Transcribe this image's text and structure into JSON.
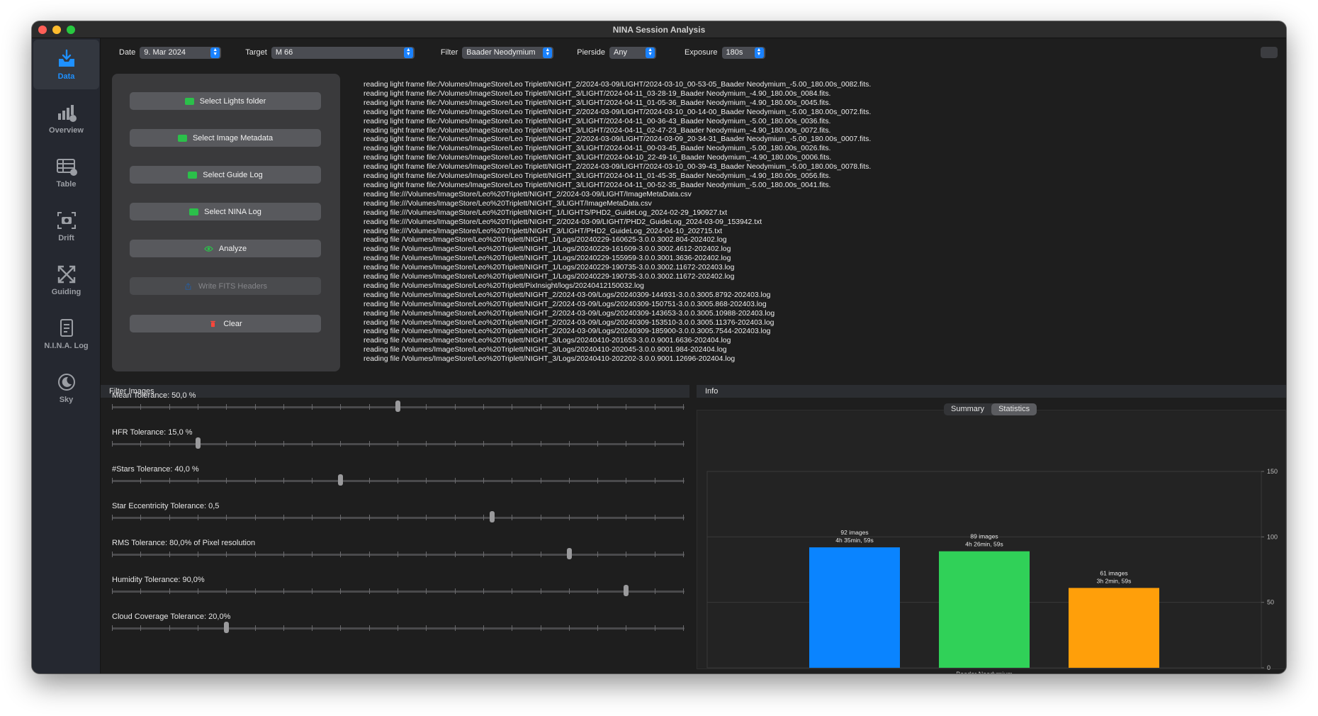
{
  "window": {
    "title": "NINA Session Analysis"
  },
  "sidebar": {
    "items": [
      {
        "label": "Data",
        "icon": "tray-download-icon",
        "active": true
      },
      {
        "label": "Overview",
        "icon": "chart-badge-icon",
        "active": false
      },
      {
        "label": "Table",
        "icon": "table-icon",
        "active": false
      },
      {
        "label": "Drift",
        "icon": "camera-viewfinder-icon",
        "active": false
      },
      {
        "label": "Guiding",
        "icon": "arrows-cross-icon",
        "active": false
      },
      {
        "label": "N.I.N.A. Log",
        "icon": "document-icon",
        "active": false
      },
      {
        "label": "Sky",
        "icon": "moon-icon",
        "active": false
      }
    ]
  },
  "toolbar": {
    "date_label": "Date",
    "date_value": "9. Mar 2024",
    "target_label": "Target",
    "target_value": "M 66",
    "filter_label": "Filter",
    "filter_value": "Baader Neodymium",
    "pierside_label": "Pierside",
    "pierside_value": "Any",
    "exposure_label": "Exposure",
    "exposure_value": "180s"
  },
  "buttons": {
    "select_lights": "Select Lights folder",
    "select_metadata": "Select Image Metadata",
    "select_guide_log": "Select Guide Log",
    "select_nina_log": "Select NINA Log",
    "analyze": "Analyze",
    "write_fits": "Write FITS Headers",
    "clear": "Clear"
  },
  "log_lines": [
    "reading light frame file:/Volumes/ImageStore/Leo Triplett/NIGHT_2/2024-03-09/LIGHT/2024-03-10_00-53-05_Baader Neodymium_-5.00_180.00s_0082.fits.",
    "reading light frame file:/Volumes/ImageStore/Leo Triplett/NIGHT_3/LIGHT/2024-04-11_03-28-19_Baader Neodymium_-4.90_180.00s_0084.fits.",
    "reading light frame file:/Volumes/ImageStore/Leo Triplett/NIGHT_3/LIGHT/2024-04-11_01-05-36_Baader Neodymium_-4.90_180.00s_0045.fits.",
    "reading light frame file:/Volumes/ImageStore/Leo Triplett/NIGHT_2/2024-03-09/LIGHT/2024-03-10_00-14-00_Baader Neodymium_-5.00_180.00s_0072.fits.",
    "reading light frame file:/Volumes/ImageStore/Leo Triplett/NIGHT_3/LIGHT/2024-04-11_00-36-43_Baader Neodymium_-5.00_180.00s_0036.fits.",
    "reading light frame file:/Volumes/ImageStore/Leo Triplett/NIGHT_3/LIGHT/2024-04-11_02-47-23_Baader Neodymium_-4.90_180.00s_0072.fits.",
    "reading light frame file:/Volumes/ImageStore/Leo Triplett/NIGHT_2/2024-03-09/LIGHT/2024-03-09_20-34-31_Baader Neodymium_-5.00_180.00s_0007.fits.",
    "reading light frame file:/Volumes/ImageStore/Leo Triplett/NIGHT_3/LIGHT/2024-04-11_00-03-45_Baader Neodymium_-5.00_180.00s_0026.fits.",
    "reading light frame file:/Volumes/ImageStore/Leo Triplett/NIGHT_3/LIGHT/2024-04-10_22-49-16_Baader Neodymium_-4.90_180.00s_0006.fits.",
    "reading light frame file:/Volumes/ImageStore/Leo Triplett/NIGHT_2/2024-03-09/LIGHT/2024-03-10_00-39-43_Baader Neodymium_-5.00_180.00s_0078.fits.",
    "reading light frame file:/Volumes/ImageStore/Leo Triplett/NIGHT_3/LIGHT/2024-04-11_01-45-35_Baader Neodymium_-4.90_180.00s_0056.fits.",
    "reading light frame file:/Volumes/ImageStore/Leo Triplett/NIGHT_3/LIGHT/2024-04-11_00-52-35_Baader Neodymium_-5.00_180.00s_0041.fits.",
    "reading file:///Volumes/ImageStore/Leo%20Triplett/NIGHT_2/2024-03-09/LIGHT/ImageMetaData.csv",
    "reading file:///Volumes/ImageStore/Leo%20Triplett/NIGHT_3/LIGHT/ImageMetaData.csv",
    "reading file:///Volumes/ImageStore/Leo%20Triplett/NIGHT_1/LIGHTS/PHD2_GuideLog_2024-02-29_190927.txt",
    "reading file:///Volumes/ImageStore/Leo%20Triplett/NIGHT_2/2024-03-09/LIGHT/PHD2_GuideLog_2024-03-09_153942.txt",
    "reading file:///Volumes/ImageStore/Leo%20Triplett/NIGHT_3/LIGHT/PHD2_GuideLog_2024-04-10_202715.txt",
    "reading file /Volumes/ImageStore/Leo%20Triplett/NIGHT_1/Logs/20240229-160625-3.0.0.3002.804-202402.log",
    "reading file /Volumes/ImageStore/Leo%20Triplett/NIGHT_1/Logs/20240229-161609-3.0.0.3002.4612-202402.log",
    "reading file /Volumes/ImageStore/Leo%20Triplett/NIGHT_1/Logs/20240229-155959-3.0.0.3001.3636-202402.log",
    "reading file /Volumes/ImageStore/Leo%20Triplett/NIGHT_1/Logs/20240229-190735-3.0.0.3002.11672-202403.log",
    "reading file /Volumes/ImageStore/Leo%20Triplett/NIGHT_1/Logs/20240229-190735-3.0.0.3002.11672-202402.log",
    "reading file /Volumes/ImageStore/Leo%20Triplett/PixInsight/logs/20240412150032.log",
    "reading file /Volumes/ImageStore/Leo%20Triplett/NIGHT_2/2024-03-09/Logs/20240309-144931-3.0.0.3005.8792-202403.log",
    "reading file /Volumes/ImageStore/Leo%20Triplett/NIGHT_2/2024-03-09/Logs/20240309-150751-3.0.0.3005.868-202403.log",
    "reading file /Volumes/ImageStore/Leo%20Triplett/NIGHT_2/2024-03-09/Logs/20240309-143653-3.0.0.3005.10988-202403.log",
    "reading file /Volumes/ImageStore/Leo%20Triplett/NIGHT_2/2024-03-09/Logs/20240309-153510-3.0.0.3005.11376-202403.log",
    "reading file /Volumes/ImageStore/Leo%20Triplett/NIGHT_2/2024-03-09/Logs/20240309-185900-3.0.0.3005.7544-202403.log",
    "reading file /Volumes/ImageStore/Leo%20Triplett/NIGHT_3/Logs/20240410-201653-3.0.0.9001.6636-202404.log",
    "reading file /Volumes/ImageStore/Leo%20Triplett/NIGHT_3/Logs/20240410-202045-3.0.0.9001.984-202404.log",
    "reading file /Volumes/ImageStore/Leo%20Triplett/NIGHT_3/Logs/20240410-202202-3.0.0.9001.12696-202404.log"
  ],
  "filter_images": {
    "header": "Filter Images",
    "sliders": [
      {
        "label": "Mean Tolerance: 50,0 %",
        "value": 0.5
      },
      {
        "label": "HFR Tolerance: 15,0 %",
        "value": 0.15
      },
      {
        "label": "#Stars Tolerance: 40,0 %",
        "value": 0.4
      },
      {
        "label": "Star Eccentricity Tolerance: 0,5",
        "value": 0.665
      },
      {
        "label": "RMS Tolerance: 80,0% of Pixel resolution",
        "value": 0.8
      },
      {
        "label": "Humidity Tolerance: 90,0%",
        "value": 0.9
      },
      {
        "label": "Cloud Coverage Tolerance: 20,0%",
        "value": 0.2
      }
    ]
  },
  "info": {
    "header": "Info",
    "tabs": [
      {
        "label": "Summary",
        "selected": false
      },
      {
        "label": "Statistics",
        "selected": true
      }
    ]
  },
  "chart_data": {
    "type": "bar",
    "categories": [
      "Baader Neodymium"
    ],
    "series": [
      {
        "values": [
          92
        ],
        "color": "#0a84ff",
        "label_line1": "92 images",
        "label_line2": "4h 35min, 59s"
      },
      {
        "values": [
          89
        ],
        "color": "#30d158",
        "label_line1": "89 images",
        "label_line2": "4h 26min, 59s"
      },
      {
        "values": [
          61
        ],
        "color": "#ff9f0a",
        "label_line1": "61 images",
        "label_line2": "3h 2min, 59s"
      }
    ],
    "yticks": [
      "0",
      "50",
      "100",
      "150"
    ],
    "ylim": [
      0,
      150
    ],
    "xlabel": "Baader Neodymium",
    "grid": true,
    "y_axis_side": "right"
  }
}
